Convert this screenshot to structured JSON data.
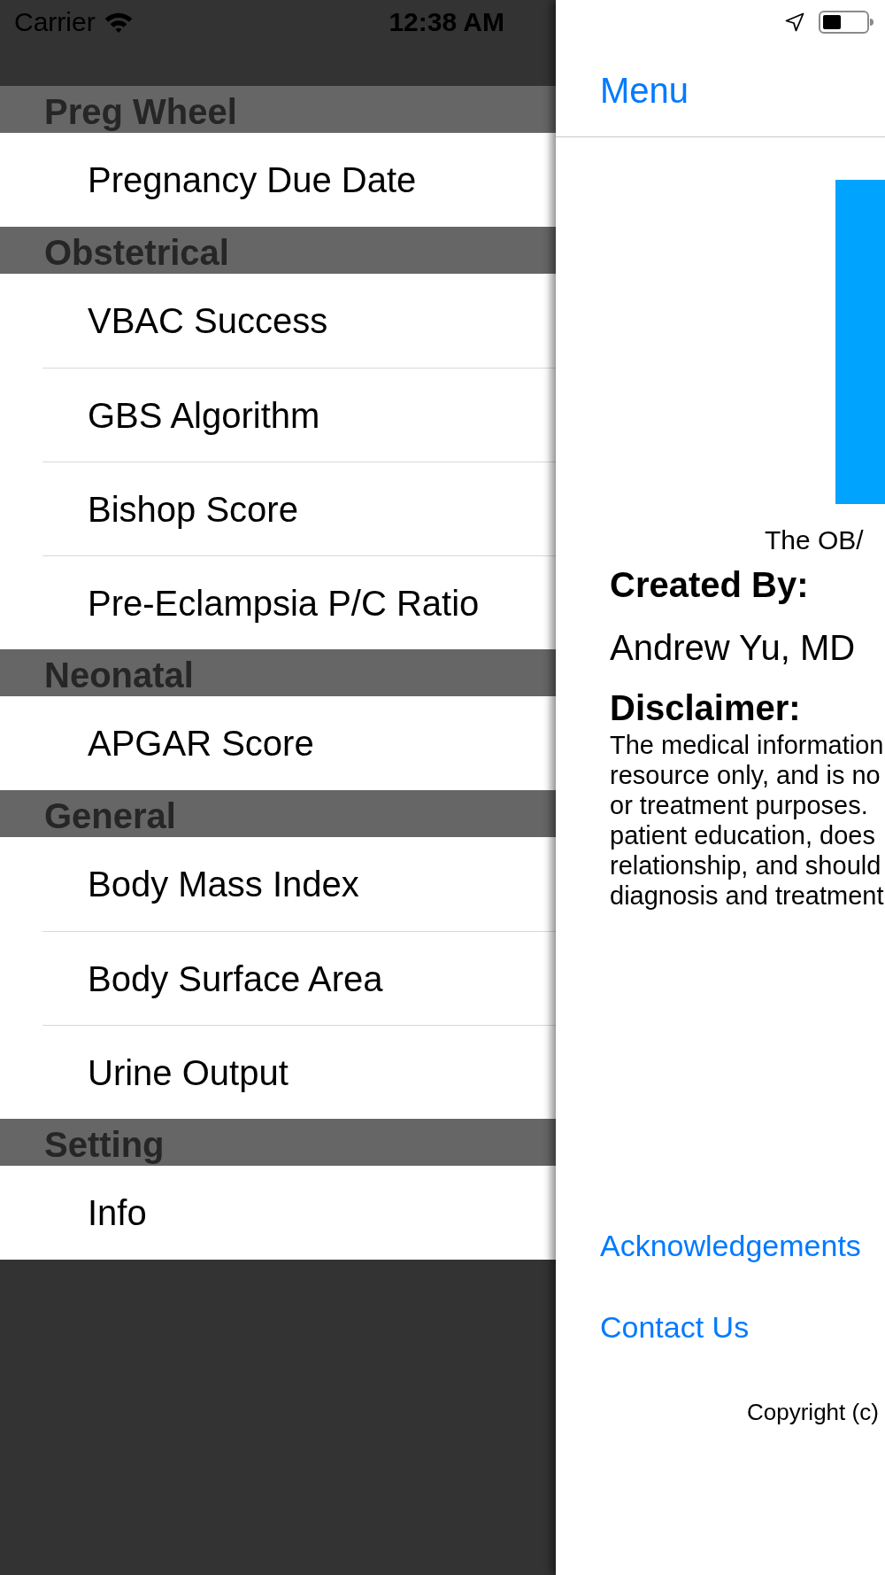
{
  "status_bar": {
    "carrier": "Carrier",
    "time": "12:38 AM"
  },
  "menu": {
    "sections": [
      {
        "title": "Preg Wheel",
        "items": [
          "Pregnancy Due Date"
        ]
      },
      {
        "title": "Obstetrical",
        "items": [
          "VBAC Success",
          "GBS Algorithm",
          "Bishop Score",
          "Pre-Eclampsia P/C Ratio"
        ]
      },
      {
        "title": "Neonatal",
        "items": [
          "APGAR Score"
        ]
      },
      {
        "title": "General",
        "items": [
          "Body Mass Index",
          "Body Surface Area",
          "Urine Output"
        ]
      },
      {
        "title": "Setting",
        "items": [
          "Info"
        ]
      }
    ]
  },
  "detail": {
    "nav": {
      "back_button": "Menu"
    },
    "logo_caption": "The OB/",
    "created_by_heading": "Created By:",
    "author": "Andrew Yu, MD",
    "disclaimer_heading": "Disclaimer:",
    "disclaimer_lines": [
      "The medical information",
      "resource only, and is no",
      "or treatment purposes.",
      "patient education, does",
      "relationship, and should",
      "diagnosis and treatment"
    ],
    "links": {
      "acknowledgements": "Acknowledgements",
      "contact": "Contact Us"
    },
    "copyright": "Copyright (c)"
  }
}
